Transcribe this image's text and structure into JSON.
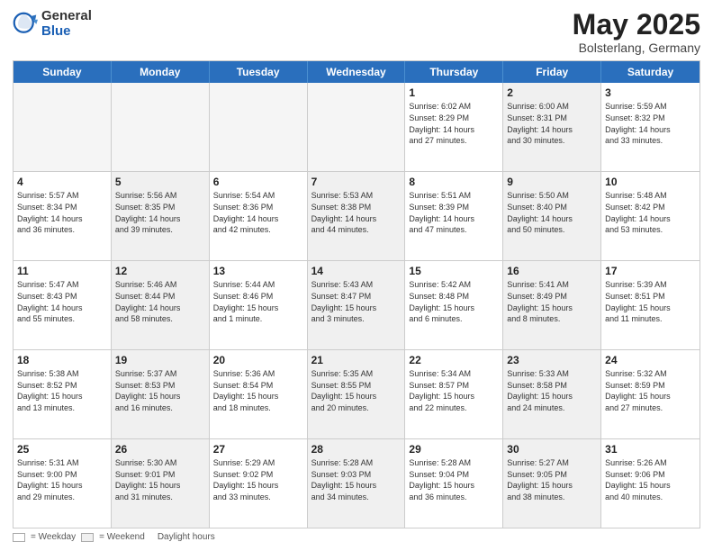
{
  "logo": {
    "general": "General",
    "blue": "Blue"
  },
  "title": {
    "month": "May 2025",
    "location": "Bolsterlang, Germany"
  },
  "weekdays": [
    "Sunday",
    "Monday",
    "Tuesday",
    "Wednesday",
    "Thursday",
    "Friday",
    "Saturday"
  ],
  "rows": [
    [
      {
        "day": "",
        "info": "",
        "shaded": false,
        "empty": true
      },
      {
        "day": "",
        "info": "",
        "shaded": false,
        "empty": true
      },
      {
        "day": "",
        "info": "",
        "shaded": false,
        "empty": true
      },
      {
        "day": "",
        "info": "",
        "shaded": false,
        "empty": true
      },
      {
        "day": "1",
        "info": "Sunrise: 6:02 AM\nSunset: 8:29 PM\nDaylight: 14 hours\nand 27 minutes.",
        "shaded": false
      },
      {
        "day": "2",
        "info": "Sunrise: 6:00 AM\nSunset: 8:31 PM\nDaylight: 14 hours\nand 30 minutes.",
        "shaded": true
      },
      {
        "day": "3",
        "info": "Sunrise: 5:59 AM\nSunset: 8:32 PM\nDaylight: 14 hours\nand 33 minutes.",
        "shaded": false
      }
    ],
    [
      {
        "day": "4",
        "info": "Sunrise: 5:57 AM\nSunset: 8:34 PM\nDaylight: 14 hours\nand 36 minutes.",
        "shaded": false
      },
      {
        "day": "5",
        "info": "Sunrise: 5:56 AM\nSunset: 8:35 PM\nDaylight: 14 hours\nand 39 minutes.",
        "shaded": true
      },
      {
        "day": "6",
        "info": "Sunrise: 5:54 AM\nSunset: 8:36 PM\nDaylight: 14 hours\nand 42 minutes.",
        "shaded": false
      },
      {
        "day": "7",
        "info": "Sunrise: 5:53 AM\nSunset: 8:38 PM\nDaylight: 14 hours\nand 44 minutes.",
        "shaded": true
      },
      {
        "day": "8",
        "info": "Sunrise: 5:51 AM\nSunset: 8:39 PM\nDaylight: 14 hours\nand 47 minutes.",
        "shaded": false
      },
      {
        "day": "9",
        "info": "Sunrise: 5:50 AM\nSunset: 8:40 PM\nDaylight: 14 hours\nand 50 minutes.",
        "shaded": true
      },
      {
        "day": "10",
        "info": "Sunrise: 5:48 AM\nSunset: 8:42 PM\nDaylight: 14 hours\nand 53 minutes.",
        "shaded": false
      }
    ],
    [
      {
        "day": "11",
        "info": "Sunrise: 5:47 AM\nSunset: 8:43 PM\nDaylight: 14 hours\nand 55 minutes.",
        "shaded": false
      },
      {
        "day": "12",
        "info": "Sunrise: 5:46 AM\nSunset: 8:44 PM\nDaylight: 14 hours\nand 58 minutes.",
        "shaded": true
      },
      {
        "day": "13",
        "info": "Sunrise: 5:44 AM\nSunset: 8:46 PM\nDaylight: 15 hours\nand 1 minute.",
        "shaded": false
      },
      {
        "day": "14",
        "info": "Sunrise: 5:43 AM\nSunset: 8:47 PM\nDaylight: 15 hours\nand 3 minutes.",
        "shaded": true
      },
      {
        "day": "15",
        "info": "Sunrise: 5:42 AM\nSunset: 8:48 PM\nDaylight: 15 hours\nand 6 minutes.",
        "shaded": false
      },
      {
        "day": "16",
        "info": "Sunrise: 5:41 AM\nSunset: 8:49 PM\nDaylight: 15 hours\nand 8 minutes.",
        "shaded": true
      },
      {
        "day": "17",
        "info": "Sunrise: 5:39 AM\nSunset: 8:51 PM\nDaylight: 15 hours\nand 11 minutes.",
        "shaded": false
      }
    ],
    [
      {
        "day": "18",
        "info": "Sunrise: 5:38 AM\nSunset: 8:52 PM\nDaylight: 15 hours\nand 13 minutes.",
        "shaded": false
      },
      {
        "day": "19",
        "info": "Sunrise: 5:37 AM\nSunset: 8:53 PM\nDaylight: 15 hours\nand 16 minutes.",
        "shaded": true
      },
      {
        "day": "20",
        "info": "Sunrise: 5:36 AM\nSunset: 8:54 PM\nDaylight: 15 hours\nand 18 minutes.",
        "shaded": false
      },
      {
        "day": "21",
        "info": "Sunrise: 5:35 AM\nSunset: 8:55 PM\nDaylight: 15 hours\nand 20 minutes.",
        "shaded": true
      },
      {
        "day": "22",
        "info": "Sunrise: 5:34 AM\nSunset: 8:57 PM\nDaylight: 15 hours\nand 22 minutes.",
        "shaded": false
      },
      {
        "day": "23",
        "info": "Sunrise: 5:33 AM\nSunset: 8:58 PM\nDaylight: 15 hours\nand 24 minutes.",
        "shaded": true
      },
      {
        "day": "24",
        "info": "Sunrise: 5:32 AM\nSunset: 8:59 PM\nDaylight: 15 hours\nand 27 minutes.",
        "shaded": false
      }
    ],
    [
      {
        "day": "25",
        "info": "Sunrise: 5:31 AM\nSunset: 9:00 PM\nDaylight: 15 hours\nand 29 minutes.",
        "shaded": false
      },
      {
        "day": "26",
        "info": "Sunrise: 5:30 AM\nSunset: 9:01 PM\nDaylight: 15 hours\nand 31 minutes.",
        "shaded": true
      },
      {
        "day": "27",
        "info": "Sunrise: 5:29 AM\nSunset: 9:02 PM\nDaylight: 15 hours\nand 33 minutes.",
        "shaded": false
      },
      {
        "day": "28",
        "info": "Sunrise: 5:28 AM\nSunset: 9:03 PM\nDaylight: 15 hours\nand 34 minutes.",
        "shaded": true
      },
      {
        "day": "29",
        "info": "Sunrise: 5:28 AM\nSunset: 9:04 PM\nDaylight: 15 hours\nand 36 minutes.",
        "shaded": false
      },
      {
        "day": "30",
        "info": "Sunrise: 5:27 AM\nSunset: 9:05 PM\nDaylight: 15 hours\nand 38 minutes.",
        "shaded": true
      },
      {
        "day": "31",
        "info": "Sunrise: 5:26 AM\nSunset: 9:06 PM\nDaylight: 15 hours\nand 40 minutes.",
        "shaded": false
      }
    ]
  ],
  "legend": {
    "white_label": "= Weekday",
    "shaded_label": "= Weekend",
    "daylight_label": "Daylight hours"
  }
}
